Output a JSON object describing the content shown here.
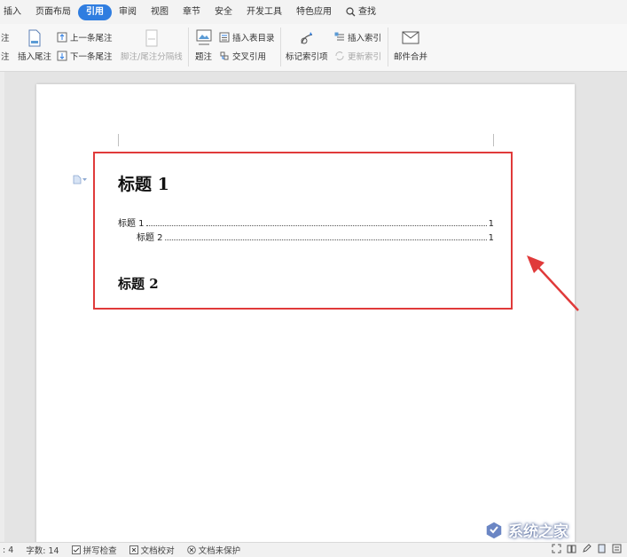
{
  "menu": {
    "items": [
      {
        "label": "插入",
        "active": false
      },
      {
        "label": "页面布局",
        "active": false
      },
      {
        "label": "引用",
        "active": true
      },
      {
        "label": "审阅",
        "active": false
      },
      {
        "label": "视图",
        "active": false
      },
      {
        "label": "章节",
        "active": false
      },
      {
        "label": "安全",
        "active": false
      },
      {
        "label": "开发工具",
        "active": false
      },
      {
        "label": "特色应用",
        "active": false
      }
    ],
    "search_label": "查找",
    "accent": "#2f7de0"
  },
  "ribbon": {
    "cut_top": "注",
    "cut_bottom": "注",
    "insert_endnote": "插入尾注",
    "prev_endnote": "上一条尾注",
    "next_endnote": "下一条尾注",
    "footnote_separator": "脚注/尾注分隔线",
    "caption": "题注",
    "insert_table_toc": "插入表目录",
    "cross_reference": "交叉引用",
    "mark_index_entry": "标记索引项",
    "insert_index": "插入索引",
    "update_index": "更新索引",
    "mail_merge": "邮件合并"
  },
  "document": {
    "heading1": "标题 1",
    "toc": [
      {
        "text": "标题 1",
        "page": "1",
        "level": 1
      },
      {
        "text": "标题 2",
        "page": "1",
        "level": 2
      }
    ],
    "heading2": "标题 2",
    "highlight_color": "#e03a3a"
  },
  "status": {
    "page_fragment": ": 4",
    "word_count": "字数: 14",
    "spell_check": "拼写检查",
    "doc_proof": "文档校对",
    "doc_unprotected": "文档未保护"
  },
  "watermark": {
    "text": "系统之家"
  }
}
